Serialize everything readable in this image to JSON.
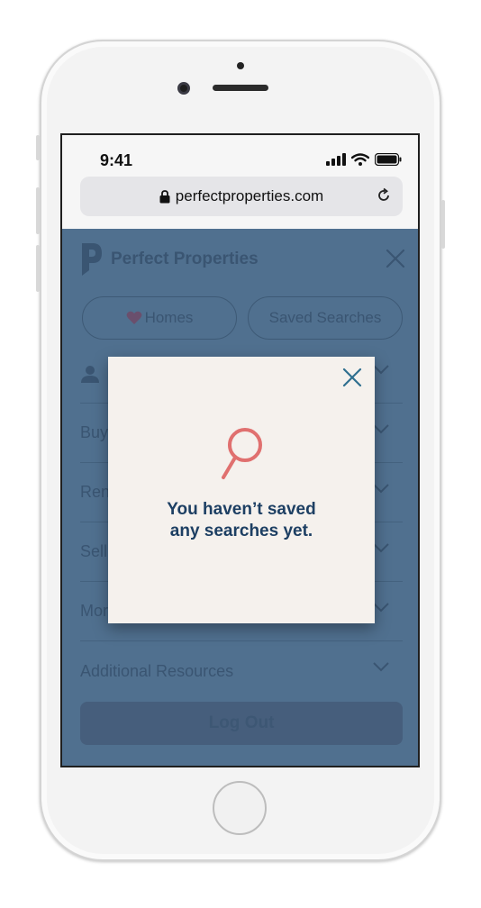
{
  "status_bar": {
    "time": "9:41"
  },
  "browser": {
    "url": "perfectproperties.com"
  },
  "app": {
    "brand_name": "Perfect Properties",
    "tabs": [
      {
        "label": "Homes",
        "icon": "heart-icon"
      },
      {
        "label": "Saved Searches"
      }
    ],
    "menu_items": [
      {
        "label": "",
        "icon": "user-icon"
      },
      {
        "label": "Buy"
      },
      {
        "label": "Rent"
      },
      {
        "label": "Sell"
      },
      {
        "label": "Mortgage"
      },
      {
        "label": "Additional Resources"
      }
    ],
    "logout_label": "Log Out"
  },
  "modal": {
    "message_line1": "You haven’t saved",
    "message_line2": "any searches yet.",
    "icon": "search-icon"
  },
  "colors": {
    "overlay_blue": "#50708f",
    "modal_bg": "#f5f1ed",
    "accent_red": "#e0706f",
    "text_navy": "#1d3f63",
    "close_teal": "#2f6f8f"
  }
}
